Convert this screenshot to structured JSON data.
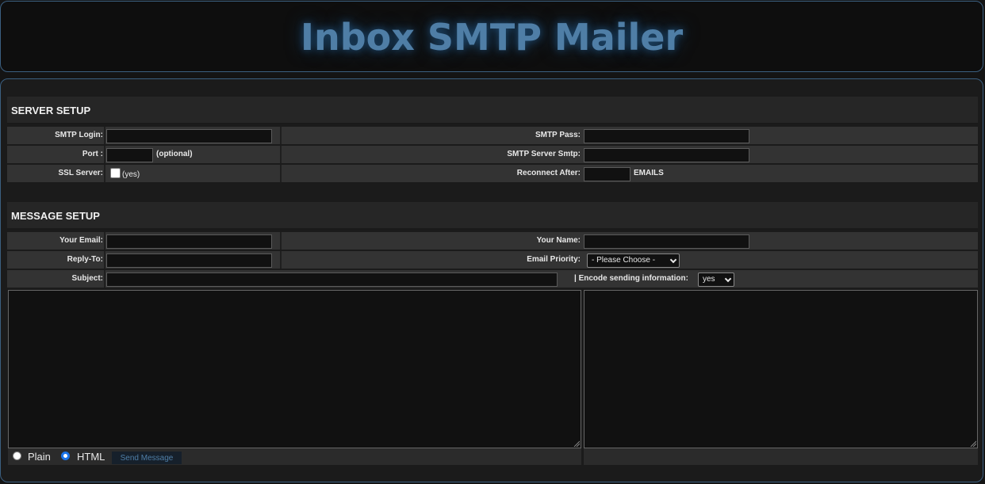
{
  "header": {
    "title": "Inbox SMTP Mailer"
  },
  "server_setup": {
    "heading": "SERVER SETUP",
    "smtp_login_label": "SMTP Login:",
    "smtp_login_value": "",
    "smtp_pass_label": "SMTP Pass:",
    "smtp_pass_value": "",
    "port_label": "Port :",
    "port_value": "",
    "port_hint": "(optional)",
    "smtp_server_label": "SMTP Server Smtp:",
    "smtp_server_value": "",
    "ssl_label": "SSL Server:",
    "ssl_hint": "(yes)",
    "ssl_checked": false,
    "reconnect_label": "Reconnect After:",
    "reconnect_value": "",
    "reconnect_unit": "EMAILS"
  },
  "message_setup": {
    "heading": "MESSAGE SETUP",
    "your_email_label": "Your Email:",
    "your_email_value": "",
    "your_name_label": "Your Name:",
    "your_name_value": "",
    "reply_to_label": "Reply-To:",
    "reply_to_value": "",
    "priority_label": "Email Priority:",
    "priority_selected": "- Please Choose -",
    "subject_label": "Subject:",
    "subject_value": "",
    "encode_label": "| Encode sending information:",
    "encode_selected": "yes",
    "message_body": "",
    "email_list": ""
  },
  "footer": {
    "plain_label": "Plain",
    "html_label": "HTML",
    "format_selected": "HTML",
    "send_label": "Send Message"
  },
  "colors": {
    "accent": "#4f7ea6",
    "background": "#141414",
    "row": "#333333"
  }
}
